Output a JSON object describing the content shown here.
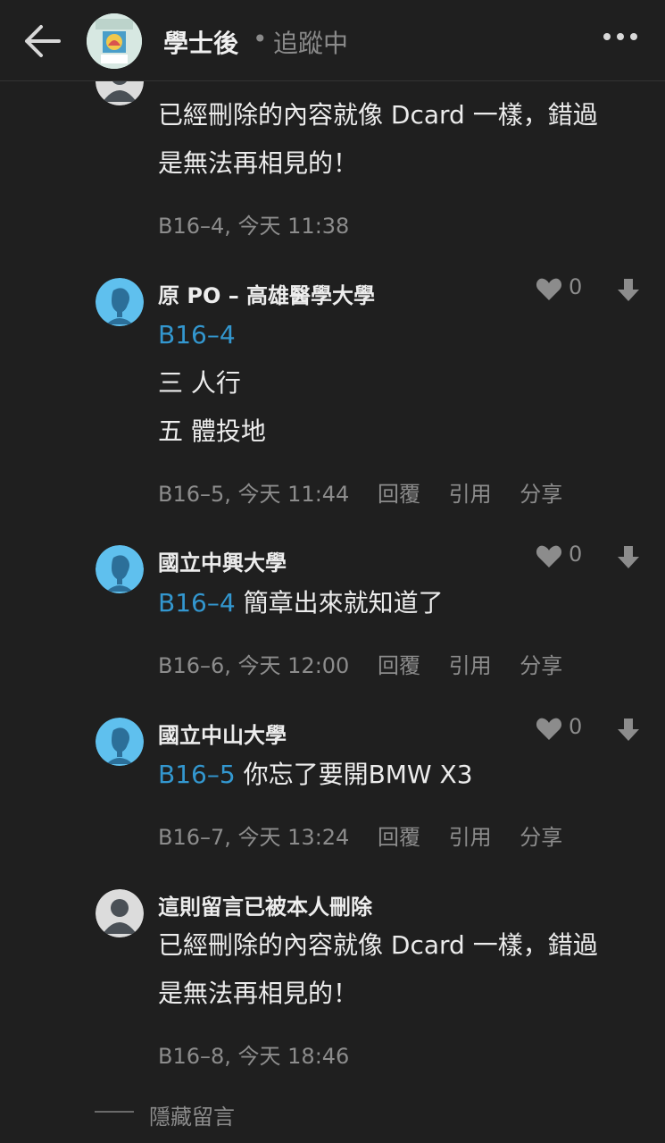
{
  "header": {
    "board_name": "學士後",
    "separator": "•",
    "follow_status": "追蹤中"
  },
  "comments": [
    {
      "body_lines": [
        "已經刪除的內容就像 Dcard 一樣，錯過",
        "是無法再相見的！"
      ],
      "meta": "B16–4, 今天 11:38"
    },
    {
      "author": "原 PO – 高雄醫學大學",
      "like_count": "0",
      "reply_ref": "B16–4",
      "body_lines": [
        "三 人行",
        "五 體投地"
      ],
      "meta": "B16–5, 今天 11:44",
      "actions": [
        "回覆",
        "引用",
        "分享"
      ]
    },
    {
      "author": "國立中興大學",
      "like_count": "0",
      "reply_ref": "B16–4",
      "body_text": "簡章出來就知道了",
      "meta": "B16–6, 今天 12:00",
      "actions": [
        "回覆",
        "引用",
        "分享"
      ]
    },
    {
      "author": "國立中山大學",
      "like_count": "0",
      "reply_ref": "B16–5",
      "body_text": "你忘了要開BMW X3",
      "meta": "B16–7, 今天 13:24",
      "actions": [
        "回覆",
        "引用",
        "分享"
      ]
    },
    {
      "author": "這則留言已被本人刪除",
      "body_lines": [
        "已經刪除的內容就像 Dcard 一樣，錯過",
        "是無法再相見的！"
      ],
      "meta": "B16–8, 今天 18:46"
    }
  ],
  "footer": {
    "hidden_comments_label": "隱藏留言"
  },
  "colors": {
    "background": "#1f1f1f",
    "link": "#3397cf",
    "secondary_text": "#8c8c8c",
    "avatar_blue": "#5fc0ee"
  },
  "icons": [
    "back-arrow-icon",
    "more-icon",
    "heart-icon",
    "down-arrow-icon",
    "user-avatar-icon"
  ]
}
